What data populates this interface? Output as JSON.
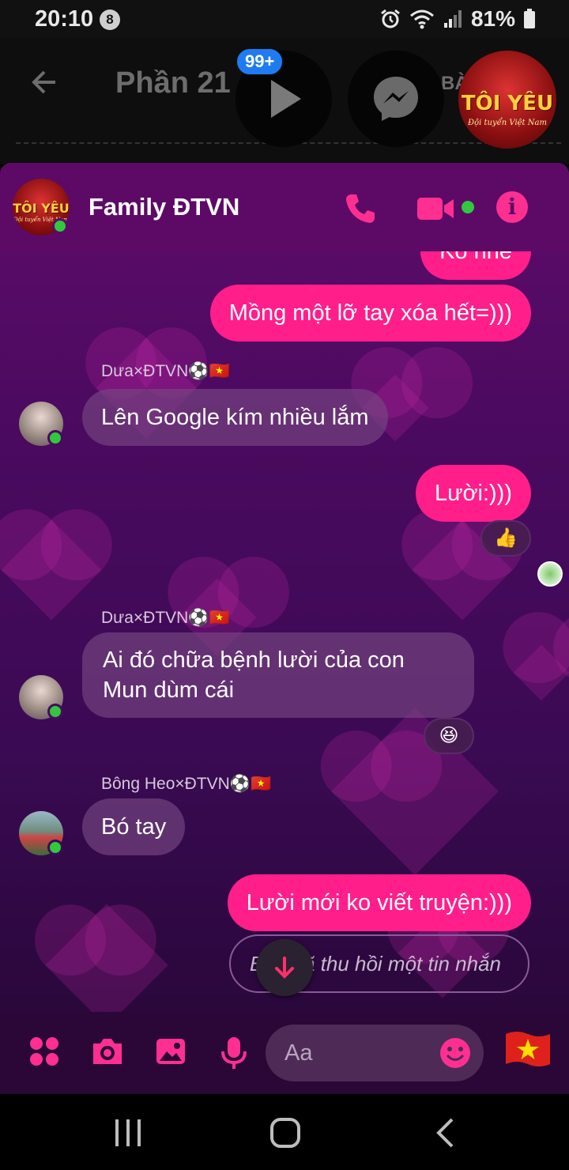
{
  "status_bar": {
    "time": "20:10",
    "notification_count": "8",
    "battery": "81%"
  },
  "background_app": {
    "title": "Phần 21",
    "title_fragment": "BÀ"
  },
  "bubble_heads": {
    "unread_badge": "99+",
    "avatar_logo": "TÔI YÊU",
    "avatar_logo_sub": "Đội tuyển Việt Nam"
  },
  "chat_header": {
    "title": "Family ĐTVN",
    "avatar_logo": "TÔI YÊU",
    "avatar_logo_sub": "Đội tuyển Việt Nam"
  },
  "messages": {
    "partial_top": "Ko nhe",
    "m1": "Mồng một lỡ tay xóa hết=)))",
    "sender1": "Dưa×ĐTVN⚽🇻🇳",
    "m2": "Lên Google kím nhiều lắm",
    "m3": "Lười:)))",
    "reaction1": "👍",
    "sender2": "Dưa×ĐTVN⚽🇻🇳",
    "m4": "Ai đó chữa bệnh lười của con Mun dùm cái",
    "reaction2": "😆",
    "sender3": "Bông Heo×ĐTVN⚽🇻🇳",
    "m5": "Bó tay",
    "m6": "Lười mới ko viết truyện:)))",
    "recalled": "Bạn đã thu hồi một tin nhắn"
  },
  "composer": {
    "placeholder": "Aa",
    "flag": "🇻🇳"
  },
  "colors": {
    "accent": "#ff1e8a",
    "header": "#5d0a66",
    "online": "#31c83d"
  }
}
